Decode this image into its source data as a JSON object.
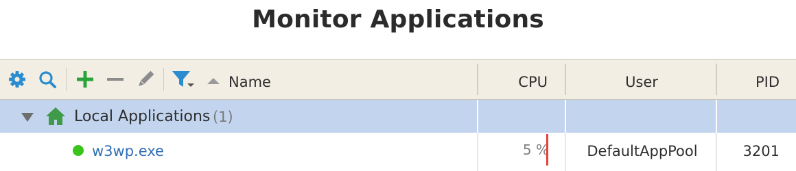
{
  "page": {
    "title": "Monitor Applications"
  },
  "toolbar": {
    "icons": [
      "gear-icon",
      "search-icon",
      "plus-icon",
      "minus-icon",
      "pencil-icon",
      "filter-icon"
    ]
  },
  "columns": {
    "name": "Name",
    "cpu": "CPU",
    "user": "User",
    "pid": "PID"
  },
  "groups": [
    {
      "label": "Local Applications",
      "count": "(1)",
      "items": [
        {
          "name": "w3wp.exe",
          "status": "running",
          "cpu": "5 %",
          "user": "DefaultAppPool",
          "pid": "3201"
        }
      ]
    }
  ],
  "colors": {
    "accent_blue": "#2b8ccf",
    "add_green": "#2aa43a",
    "group_row_bg": "#c2d4ee",
    "header_bg": "#f2eee3",
    "status_running": "#3bc41b",
    "cpu_bar": "#e8413b",
    "link_text": "#2f6fb5"
  }
}
